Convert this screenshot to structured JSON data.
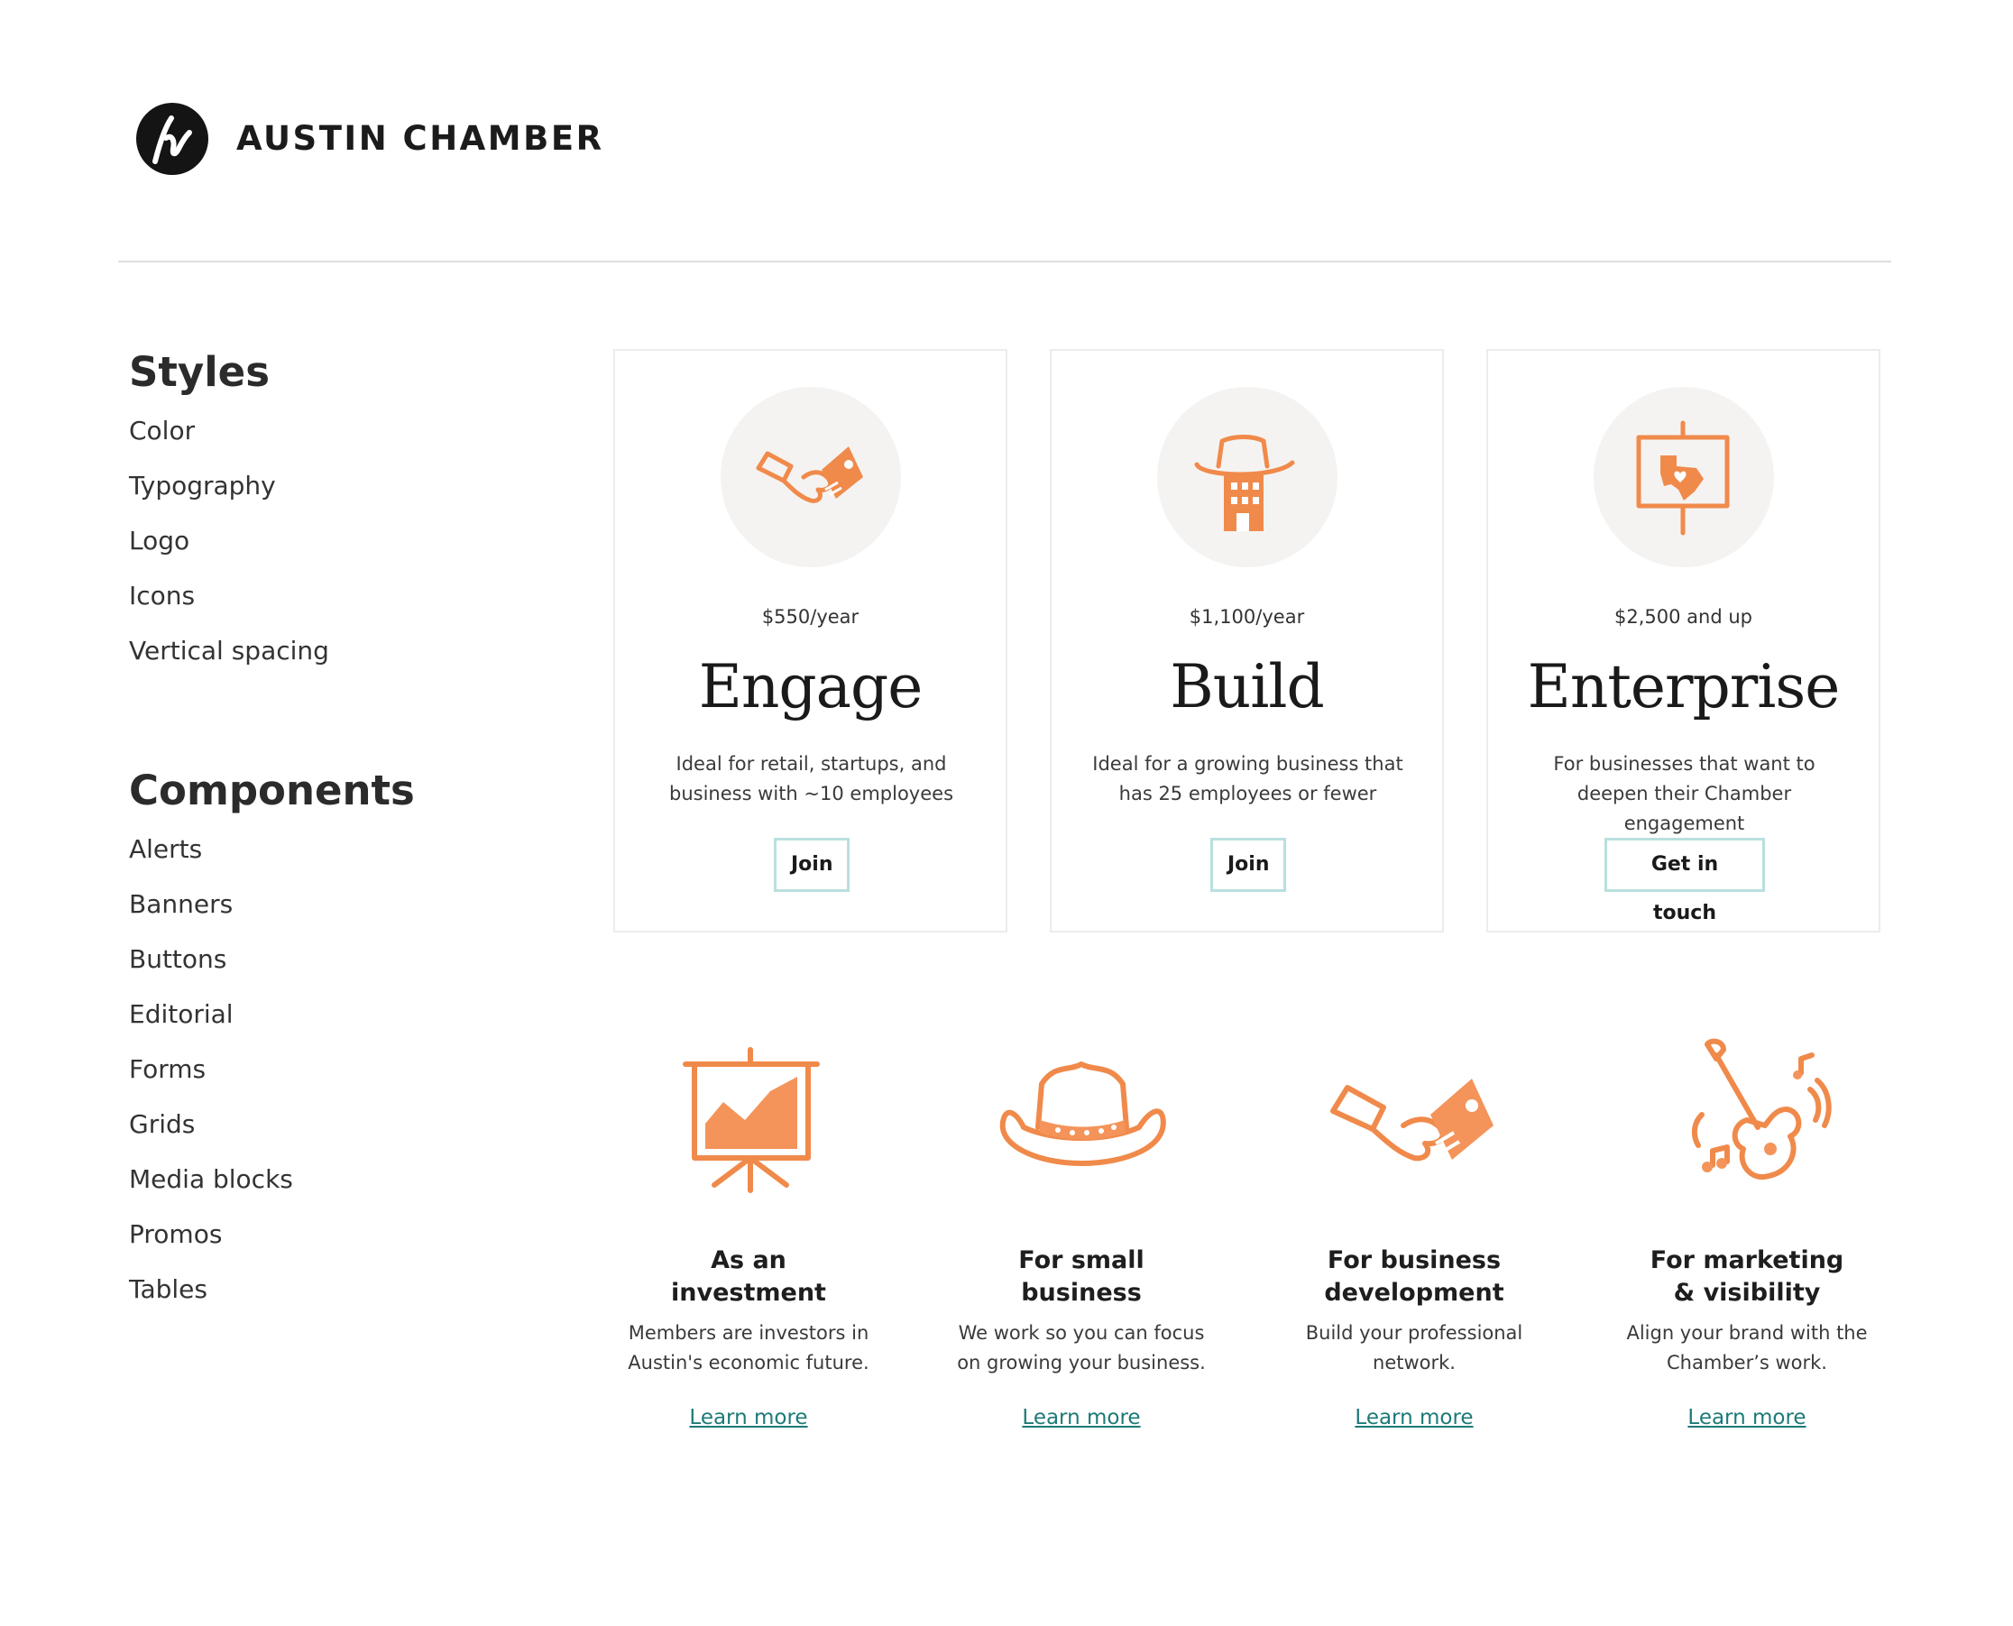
{
  "brand": {
    "name": "AUSTIN CHAMBER",
    "accent": "#f08a4b",
    "link_color": "#1d7a78",
    "button_border": "#b8e0de"
  },
  "sidebar": {
    "styles_heading": "Styles",
    "styles_items": [
      "Color",
      "Typography",
      "Logo",
      "Icons",
      "Vertical spacing"
    ],
    "components_heading": "Components",
    "components_items": [
      "Alerts",
      "Banners",
      "Buttons",
      "Editorial",
      "Forms",
      "Grids",
      "Media blocks",
      "Promos",
      "Tables"
    ]
  },
  "cards": [
    {
      "icon": "handshake-icon",
      "price": "$550/year",
      "title": "Engage",
      "desc": "Ideal for retail, startups, and business with ~10 employees",
      "button": "Join"
    },
    {
      "icon": "building-cowboy-hat-icon",
      "price": "$1,100/year",
      "title": "Build",
      "desc": "Ideal for a growing business that has 25 employees or fewer",
      "button": "Join"
    },
    {
      "icon": "texas-sign-icon",
      "price": "$2,500 and up",
      "title": "Enterprise",
      "desc": "For businesses that want to deepen their Chamber engagement",
      "button": "Get in touch"
    }
  ],
  "features": [
    {
      "icon": "presentation-chart-icon",
      "title": "As an investment",
      "desc": "Members are investors in Austin's economic future.",
      "link": "Learn more"
    },
    {
      "icon": "cowboy-hat-icon",
      "title": "For small business",
      "desc": "We work so you can focus on growing your business.",
      "link": "Learn more"
    },
    {
      "icon": "handshake-icon",
      "title": "For business development",
      "desc": "Build your professional network.",
      "link": "Learn more"
    },
    {
      "icon": "guitar-icon",
      "title": "For marketing & visibility",
      "desc": "Align your brand with the Chamber’s work.",
      "link": "Learn more"
    }
  ]
}
